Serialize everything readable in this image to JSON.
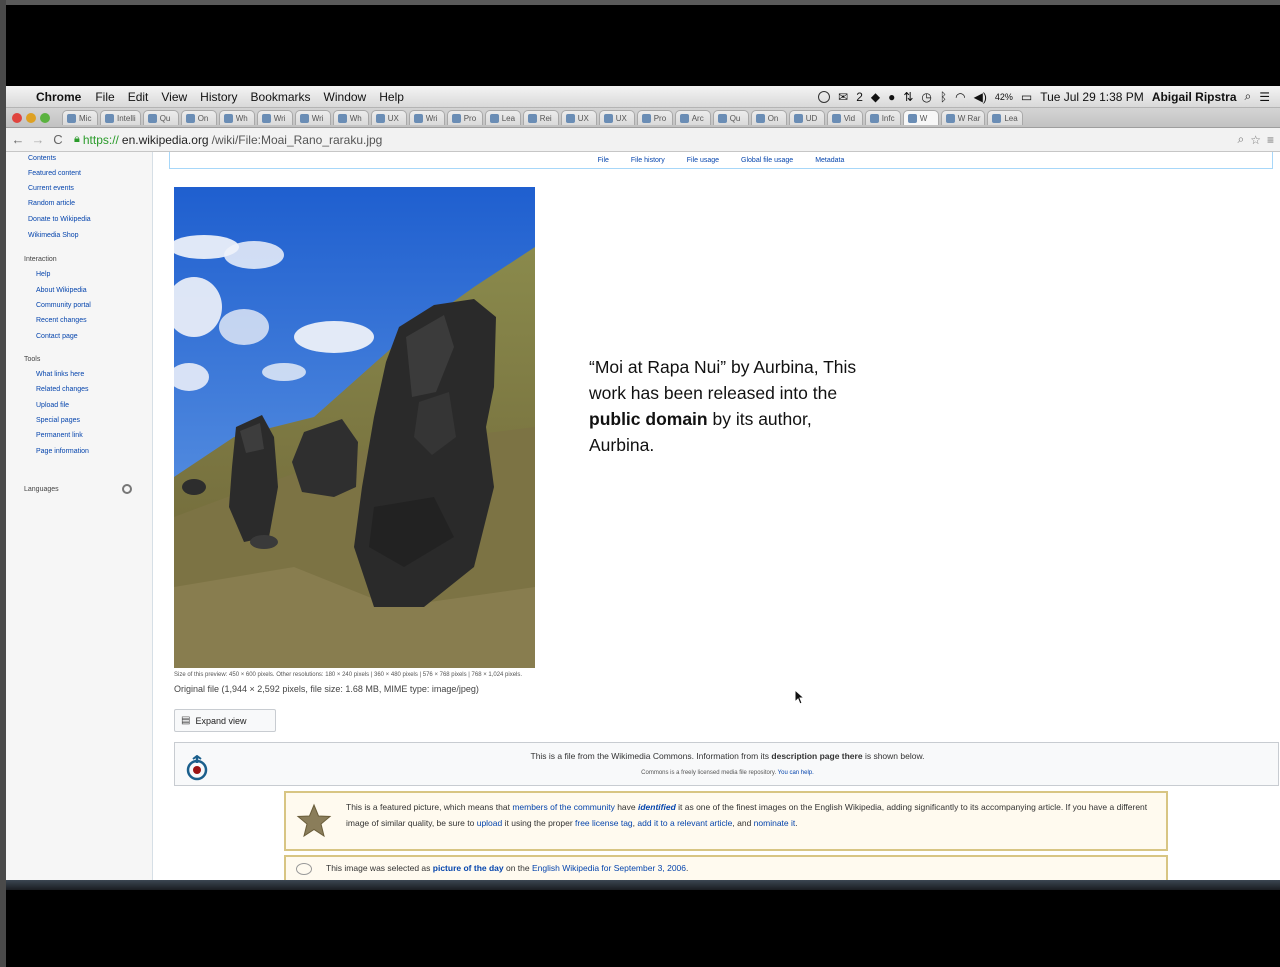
{
  "menubar": {
    "app": "Chrome",
    "menus": [
      "File",
      "Edit",
      "View",
      "History",
      "Bookmarks",
      "Window",
      "Help"
    ],
    "status": {
      "mail_count": "2",
      "battery": "42%",
      "datetime": "Tue Jul 29  1:38 PM",
      "user": "Abigail Ripstra"
    }
  },
  "tabs": [
    "Mic",
    "Intelli",
    "Qu",
    "On",
    "Wh",
    "Wri",
    "Wri",
    "Wh",
    "UX",
    "Wri",
    "Pro",
    "Lea",
    "Rei",
    "UX",
    "UX",
    "Pro",
    "Arc",
    "Qu",
    "On",
    "UD",
    "Vid",
    "Infc",
    "W",
    "W Rar",
    "Lea"
  ],
  "address": {
    "scheme": "https://",
    "host": "en.wikipedia.org",
    "path": "/wiki/File:Moai_Rano_raraku.jpg"
  },
  "sidebar": {
    "nav": [
      "Contents",
      "Featured content",
      "Current events",
      "Random article",
      "Donate to Wikipedia",
      "Wikimedia Shop"
    ],
    "interaction_heading": "Interaction",
    "interaction": [
      "Help",
      "About Wikipedia",
      "Community portal",
      "Recent changes",
      "Contact page"
    ],
    "tools_heading": "Tools",
    "tools": [
      "What links here",
      "Related changes",
      "Upload file",
      "Special pages",
      "Permanent link",
      "Page information"
    ],
    "languages_heading": "Languages"
  },
  "file_tabs": [
    "File",
    "File history",
    "File usage",
    "Global file usage",
    "Metadata"
  ],
  "caption": {
    "part1": "“Moi at Rapa Nui” by Aurbina, This work has been released into the ",
    "bold": "public domain",
    "part2": " by its author, Aurbina."
  },
  "preview_sizes": "Size of this preview: 450 × 600 pixels. Other resolutions: 180 × 240 pixels | 360 × 480 pixels | 576 × 768 pixels | 768 × 1,024 pixels.",
  "original_file": "Original file (1,944 × 2,592 pixels, file size: 1.68 MB, MIME type: image/jpeg)",
  "expand_view": "Expand view",
  "commons": {
    "text1": "This is a file from the Wikimedia Commons. Information from its ",
    "link": "description page there",
    "text2": " is shown below.",
    "sub1": "Commons is a freely licensed media file repository. ",
    "sub_link": "You can help."
  },
  "featured": {
    "t1": "This is a featured picture, which means that ",
    "l1": "members of the community",
    "t2": " have ",
    "l2": "identified",
    "t3": " it as one of the finest images on the English Wikipedia, adding significantly to its accompanying article. If you have a different image of similar quality, be sure to ",
    "l3": "upload",
    "t4": " it using the proper ",
    "l4": "free license tag",
    "t5": ", ",
    "l5": "add it to a relevant article",
    "t6": ", and ",
    "l6": "nominate it",
    "t7": "."
  },
  "potd": {
    "t1": "This image was selected as ",
    "bold": "picture of the day",
    "t2": " on the ",
    "link": "English Wikipedia for September 3, 2006",
    "t3": "."
  },
  "colors": {
    "link": "#0645ad",
    "featured_border": "#d8c583",
    "sky": "#2f6fd6"
  }
}
